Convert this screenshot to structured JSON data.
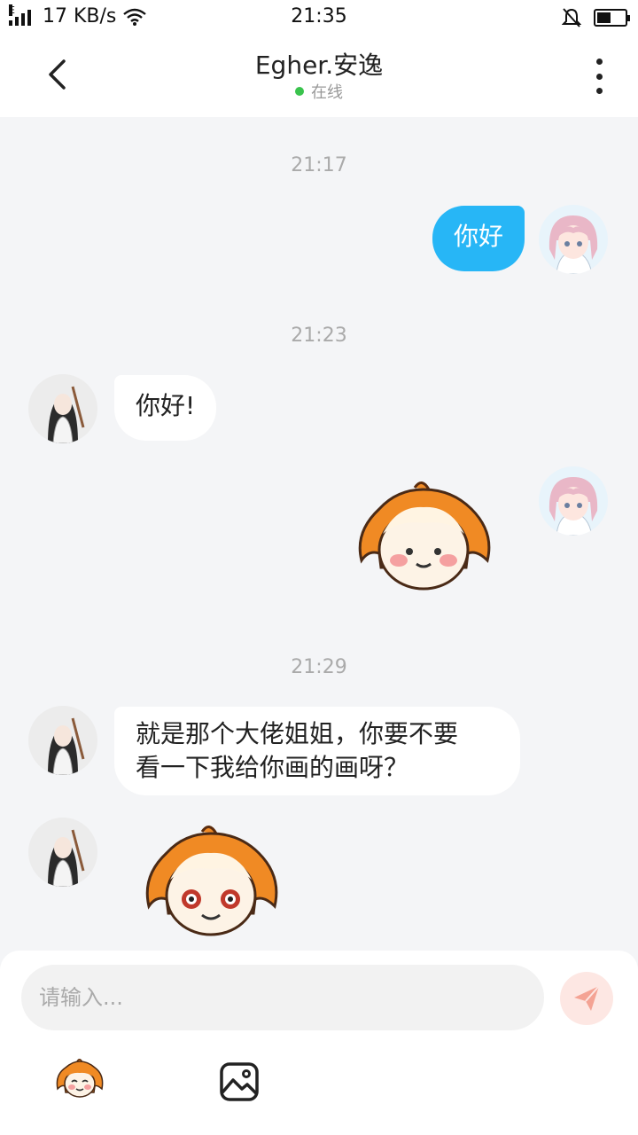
{
  "status_bar": {
    "net_label": "E",
    "speed": "17 KB/s",
    "time": "21:35",
    "battery_level": 0.5
  },
  "header": {
    "title": "Egher.安逸",
    "status": "在线"
  },
  "messages": [
    {
      "timestamp": "21:17"
    },
    {
      "sender": "me",
      "text": "你好"
    },
    {
      "timestamp": "21:23"
    },
    {
      "sender": "them",
      "text": "你好!"
    },
    {
      "sender": "me",
      "sticker": "orange-hair-smile-sticker"
    },
    {
      "timestamp": "21:29"
    },
    {
      "sender": "them",
      "text_line1": "就是那个大佬姐姐，你要不要",
      "text_line2": "看一下我给你画的画呀？"
    },
    {
      "sender": "them",
      "sticker": "orange-hair-grin-sticker"
    }
  ],
  "input": {
    "placeholder": "请输入..."
  },
  "colors": {
    "my_bubble": "#27b6f6",
    "online_dot": "#3ac34d",
    "sticker_orange": "#f08a24",
    "send_button": "#f4a394"
  },
  "icons": [
    "back-arrow-icon",
    "more-vertical-icon",
    "send-icon",
    "emoji-sticker-icon",
    "image-icon"
  ]
}
